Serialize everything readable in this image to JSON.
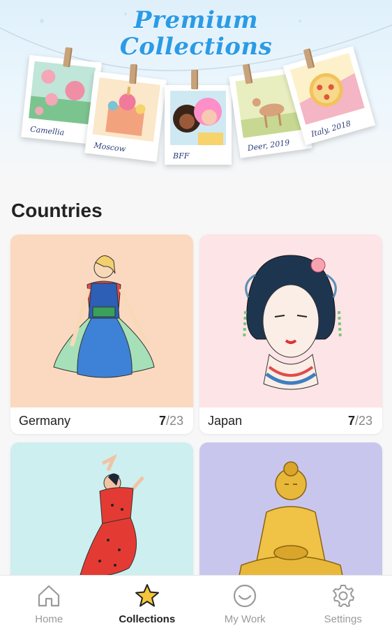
{
  "banner": {
    "title_line1": "Premium",
    "title_line2": "Collections",
    "photos": [
      {
        "caption": "Camellia",
        "icon": "camellia-art"
      },
      {
        "caption": "Moscow",
        "icon": "moscow-art"
      },
      {
        "caption": "BFF",
        "icon": "bff-art"
      },
      {
        "caption": "Deer, 2019",
        "icon": "deer-art"
      },
      {
        "caption": "Italy, 2018",
        "icon": "pizza-art"
      }
    ]
  },
  "section": {
    "title": "Countries"
  },
  "cards": [
    {
      "name": "Germany",
      "done": "7",
      "total": "/23",
      "bg": "#fbd9c0",
      "icon": "germany-dancer-art"
    },
    {
      "name": "Japan",
      "done": "7",
      "total": "/23",
      "bg": "#fde4e6",
      "icon": "geisha-art"
    },
    {
      "name": "",
      "done": "",
      "total": "",
      "bg": "#cdeff0",
      "icon": "flamenco-dancer-art"
    },
    {
      "name": "",
      "done": "",
      "total": "",
      "bg": "#c9c6ee",
      "icon": "buddha-art"
    }
  ],
  "tabs": [
    {
      "label": "Home",
      "icon": "home-icon",
      "active": false
    },
    {
      "label": "Collections",
      "icon": "star-icon",
      "active": true
    },
    {
      "label": "My Work",
      "icon": "smile-icon",
      "active": false
    },
    {
      "label": "Settings",
      "icon": "gear-icon",
      "active": false
    }
  ],
  "colors": {
    "accent": "#2b9be6",
    "star": "#f5c63a"
  }
}
